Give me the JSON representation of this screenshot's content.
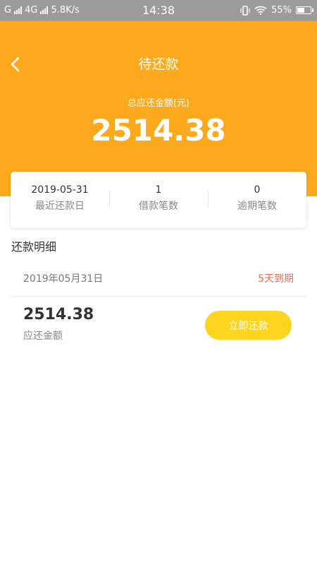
{
  "status_bar": {
    "carrier1": "G",
    "carrier2": "4G",
    "speed": "5.8K/s",
    "time": "14:38",
    "battery": "55%"
  },
  "header": {
    "title": "待还款",
    "subtitle": "总应还金额(元)",
    "total_amount": "2514.38",
    "bg_color": "#fda91e"
  },
  "summary": [
    {
      "value": "2019-05-31",
      "label": "最近还款日"
    },
    {
      "value": "1",
      "label": "借款笔数"
    },
    {
      "value": "0",
      "label": "逾期笔数"
    }
  ],
  "detail": {
    "section_title": "还款明细",
    "date": "2019年05月31日",
    "due_text": "5天到期",
    "amount": "2514.38",
    "amount_label": "应还金额",
    "pay_button": "立即还款",
    "due_color": "#f26c4f",
    "button_color": "#fdd41e"
  }
}
